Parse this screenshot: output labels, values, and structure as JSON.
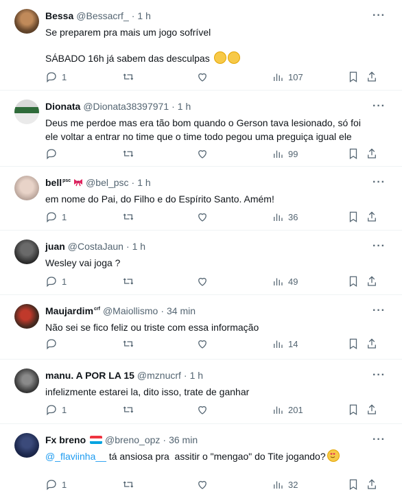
{
  "tweets": [
    {
      "name": "Bessa",
      "handle": "@Bessacrf_",
      "dot": "·",
      "time": "1 h",
      "lines": [
        "Se preparem pra mais um jogo sofrível",
        "SÁBADO 16h já sabem das desculpas"
      ],
      "emoji_icons": [
        "grinning-face-icon",
        "grinning-face-icon"
      ],
      "replies": "1",
      "views": "107"
    },
    {
      "name": "Dionata",
      "handle": "@Dionata38397971",
      "dot": "·",
      "time": "1 h",
      "lines": [
        "Deus me perdoe mas era tão bom quando o Gerson tava lesionado, só foi",
        "ele voltar a entrar no time que o time todo pegou uma preguiça igual ele"
      ],
      "replies": "",
      "views": "99"
    },
    {
      "name": "bell",
      "name_sup": "psc",
      "name_icon": "ribbon-bow-icon",
      "handle": "@bel_psc",
      "dot": "·",
      "time": "1 h",
      "lines": [
        "em nome do Pai, do Filho e do Espírito Santo. Amém!"
      ],
      "replies": "1",
      "views": "36"
    },
    {
      "name": "juan",
      "handle": "@CostaJaun",
      "dot": "·",
      "time": "1 h",
      "lines": [
        "Wesley vai joga ?"
      ],
      "replies": "1",
      "views": "49"
    },
    {
      "name": "Maujardim",
      "name_sup": "crf",
      "handle": "@Maiollismo",
      "dot": "·",
      "time": "34 min",
      "lines": [
        "Não sei se fico feliz ou triste com essa informação"
      ],
      "replies": "",
      "views": "14"
    },
    {
      "name": "manu. A POR LA 15",
      "handle": "@mznucrf",
      "dot": "·",
      "time": "1 h",
      "lines": [
        "infelizmente estarei la, dito isso, trate de ganhar"
      ],
      "replies": "1",
      "views": "201"
    },
    {
      "name": "Fx breno",
      "name_icon": "luxembourg-flag-icon",
      "handle": "@breno_opz",
      "dot": "·",
      "time": "36 min",
      "mention": "@_flaviinha__",
      "lines": [
        " tá ansiosa pra  assitir o \"mengao\" do Tite jogando?"
      ],
      "emoji_icons": [
        "heart-eyes-face-icon"
      ],
      "replies": "1",
      "views": "32"
    }
  ],
  "colors": {
    "text": "#0f1419",
    "muted": "#536471",
    "link": "#1d9bf0",
    "divider": "#eff3f4"
  }
}
